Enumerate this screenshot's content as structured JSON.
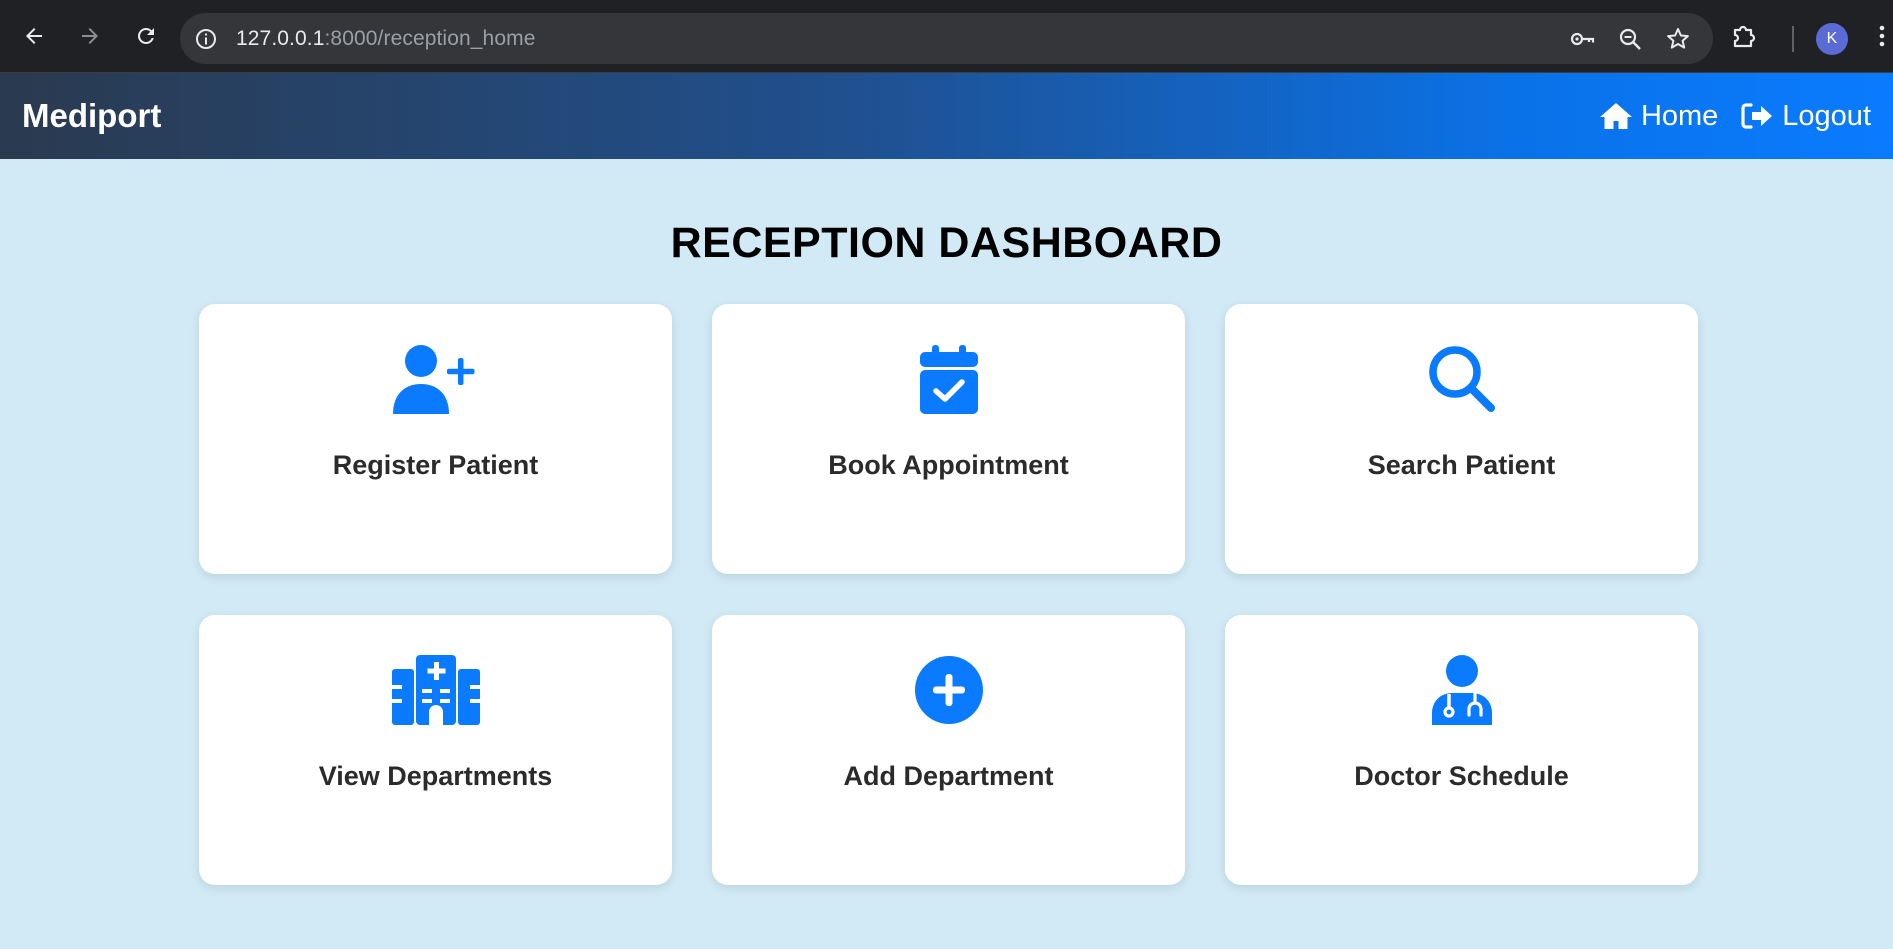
{
  "browser": {
    "url_host": "127.0.0.1",
    "url_rest": ":8000/reception_home",
    "avatar_letter": "K"
  },
  "navbar": {
    "brand": "Mediport",
    "links": [
      {
        "label": "Home",
        "icon": "home-icon"
      },
      {
        "label": "Logout",
        "icon": "logout-icon"
      }
    ]
  },
  "page": {
    "title": "RECEPTION DASHBOARD"
  },
  "cards": [
    {
      "label": "Register Patient",
      "icon": "user-plus-icon"
    },
    {
      "label": "Book Appointment",
      "icon": "calendar-check-icon"
    },
    {
      "label": "Search Patient",
      "icon": "search-icon"
    },
    {
      "label": "View Departments",
      "icon": "hospital-icon"
    },
    {
      "label": "Add Department",
      "icon": "plus-circle-icon"
    },
    {
      "label": "Doctor Schedule",
      "icon": "doctor-icon"
    }
  ],
  "colors": {
    "accent": "#0a7bff",
    "background": "#d1eaf5"
  }
}
